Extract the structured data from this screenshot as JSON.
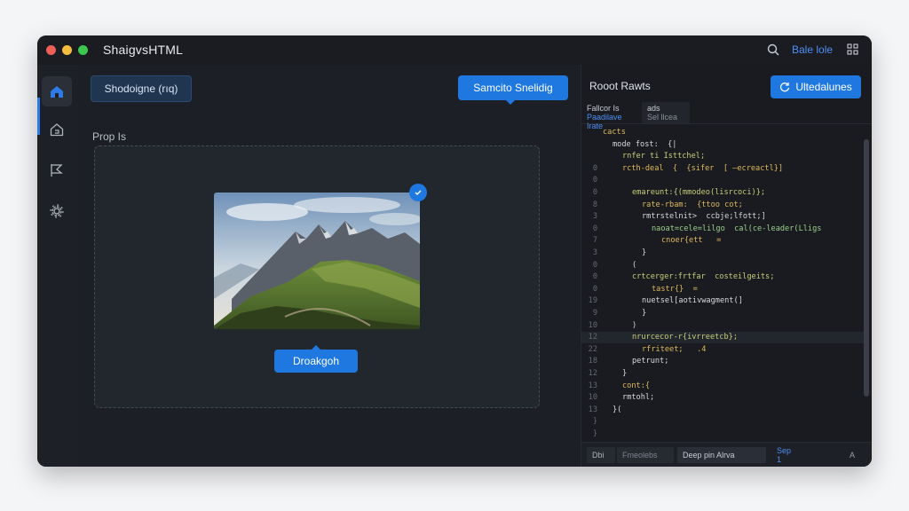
{
  "window": {
    "title": "ShaigvsHTML"
  },
  "titlebar": {
    "link": "Bale lole"
  },
  "sidebar": {
    "items": [
      {
        "icon": "home-icon",
        "active": true
      },
      {
        "icon": "house-outline-icon",
        "active": false
      },
      {
        "icon": "flag-icon",
        "active": false
      },
      {
        "icon": "gear-icon",
        "active": false
      }
    ]
  },
  "main": {
    "left_button": "Shodoigne (rıq)",
    "top_button": "Samcito Snelidig",
    "props_label": "Prop Is",
    "drop_button": "Droakgoh",
    "image": {
      "subject": "mountain landscape",
      "badge_icon": "check-icon"
    }
  },
  "panel": {
    "title": "Rooot Rawts",
    "action_button": "Ultedalunes",
    "tabs": [
      {
        "line1": "Fallcor Is",
        "line2": "Paadilave Irate"
      },
      {
        "line1": "ads",
        "line2": "Sel llcea"
      }
    ],
    "code": [
      {
        "ln": "",
        "text": "cacts",
        "color": "#e0b95b",
        "indent": 0
      },
      {
        "ln": "",
        "text": "mode fost:  {|",
        "color": "#d6d9de",
        "indent": 1
      },
      {
        "ln": "",
        "text": "rnfer ti Isttchel;",
        "color": "#c9cf7a",
        "indent": 2
      },
      {
        "ln": "0",
        "text": "rcth-deal  {  {sifer  [ —ecreactl}]",
        "color": "#e0b95b",
        "indent": 2
      },
      {
        "ln": "0",
        "text": "",
        "color": "#d6d9de",
        "indent": 0
      },
      {
        "ln": "0",
        "text": "emareunt:{(mmodeo(lisrcoci)};",
        "color": "#c9cf7a",
        "indent": 3
      },
      {
        "ln": "8",
        "text": "rate-rbam:  {ttoo cot;",
        "color": "#e0b95b",
        "indent": 4
      },
      {
        "ln": "3",
        "text": "rmtrstelnit>  ccbje;lfott;]",
        "color": "#d6d9de",
        "indent": 4
      },
      {
        "ln": "0",
        "text": "naoat=cele=lilgo  cal(ce-leader(Lligs",
        "color": "#9bd08a",
        "indent": 5
      },
      {
        "ln": "7",
        "text": "cnoer{ett   =",
        "color": "#e0b95b",
        "indent": 6
      },
      {
        "ln": "3",
        "text": "}",
        "color": "#d6d9de",
        "indent": 4
      },
      {
        "ln": "0",
        "text": "(",
        "color": "#d6d9de",
        "indent": 3
      },
      {
        "ln": "0",
        "text": "crtcerger:frtfar  costeilgeits;",
        "color": "#c9cf7a",
        "indent": 3
      },
      {
        "ln": "0",
        "text": "tastr{}  =",
        "color": "#e0b95b",
        "indent": 5
      },
      {
        "ln": "19",
        "text": "nuetsel[aotivwagment(]",
        "color": "#d6d9de",
        "indent": 4
      },
      {
        "ln": "9",
        "text": "}",
        "color": "#d6d9de",
        "indent": 4
      },
      {
        "ln": "10",
        "text": ")",
        "color": "#d6d9de",
        "indent": 3
      },
      {
        "ln": "12",
        "text": "nrurcecor-r{ivrreetcb};",
        "color": "#c9cf7a",
        "indent": 3
      },
      {
        "ln": "22",
        "text": "rfriteet;   .4",
        "color": "#e0b95b",
        "indent": 4
      },
      {
        "ln": "18",
        "text": "petrunt;",
        "color": "#d6d9de",
        "indent": 3
      },
      {
        "ln": "12",
        "text": "}",
        "color": "#d6d9de",
        "indent": 2
      },
      {
        "ln": "13",
        "text": "cont:{",
        "color": "#e0b95b",
        "indent": 2
      },
      {
        "ln": "10",
        "text": "rmtohl;",
        "color": "#d6d9de",
        "indent": 2
      },
      {
        "ln": "13",
        "text": "}(",
        "color": "#d6d9de",
        "indent": 1
      },
      {
        "ln": "}",
        "text": "",
        "color": "#d6d9de",
        "indent": 0
      },
      {
        "ln": "}",
        "text": "",
        "color": "#d6d9de",
        "indent": 0
      }
    ],
    "statusbar": {
      "seg1": "Dbi",
      "seg2": "Fmeolebs",
      "seg3": "Deep pin Alrva",
      "seg4": "Sep 1",
      "seg5": "A"
    }
  }
}
